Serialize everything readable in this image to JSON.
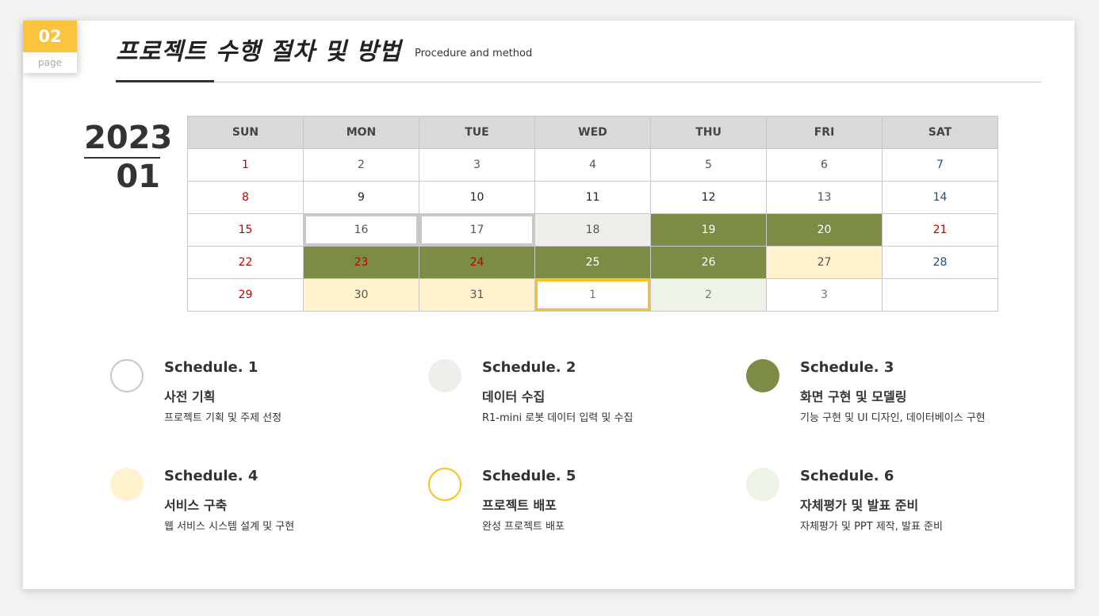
{
  "page": {
    "number": "02",
    "word": "page"
  },
  "header": {
    "title": "프로젝트 수행 절차 및 방법",
    "subtitle": "Procedure and method"
  },
  "calendar": {
    "year": "2023",
    "month": "01",
    "weekdays": [
      "SUN",
      "MON",
      "TUE",
      "WED",
      "THU",
      "FRI",
      "SAT"
    ],
    "weeks": [
      [
        "1",
        "2",
        "3",
        "4",
        "5",
        "6",
        "7"
      ],
      [
        "8",
        "9",
        "10",
        "11",
        "12",
        "13",
        "14"
      ],
      [
        "15",
        "16",
        "17",
        "18",
        "19",
        "20",
        "21"
      ],
      [
        "22",
        "23",
        "24",
        "25",
        "26",
        "27",
        "28"
      ],
      [
        "29",
        "30",
        "31",
        "1",
        "2",
        "3",
        ""
      ]
    ]
  },
  "colors": {
    "schedule1_outline": "#ccc7bf",
    "schedule2_fill": "#efeeea",
    "schedule3_fill": "#7d8c45",
    "schedule4_fill": "#fff2cc",
    "schedule5_outline": "#fcc01c",
    "schedule6_fill": "#edf3e6",
    "accent": "#fcc33c"
  },
  "schedules": [
    {
      "head": "Schedule. 1",
      "name": "사전 기획",
      "desc": "프로젝트 기획 및 주제 선정"
    },
    {
      "head": "Schedule. 2",
      "name": "데이터 수집",
      "desc": "R1-mini 로봇 데이터 입력 및 수집"
    },
    {
      "head": "Schedule. 3",
      "name": "화면 구현 및 모델링",
      "desc": "기능 구현 및 UI 디자인, 데이터베이스 구현"
    },
    {
      "head": "Schedule. 4",
      "name": "서비스 구축",
      "desc": "웹 서비스 시스템 설계 및 구현"
    },
    {
      "head": "Schedule. 5",
      "name": "프로젝트 배포",
      "desc": "완성 프로젝트 배포"
    },
    {
      "head": "Schedule. 6",
      "name": "자체평가 및 발표 준비",
      "desc": "자체평가 및 PPT 제작, 발표 준비"
    }
  ]
}
